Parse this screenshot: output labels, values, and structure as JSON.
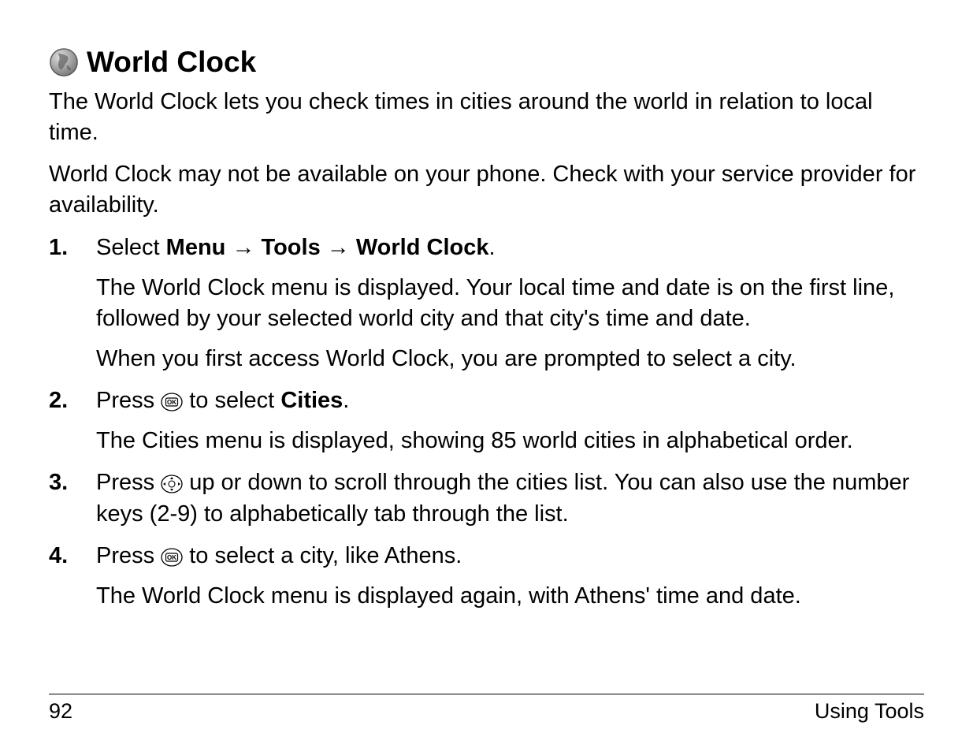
{
  "heading": "World Clock",
  "intro1": "The World Clock lets you check times in cities around the world in relation to local time.",
  "intro2": "World Clock may not be available on your phone. Check with your service provider for availability.",
  "steps": {
    "s1": {
      "prefix": "Select ",
      "menu": "Menu",
      "tools": "Tools",
      "wc": "World Clock",
      "period": ".",
      "detail1": "The World Clock menu is displayed. Your local time and date is on the first line, followed by your selected world city and that city's time and date.",
      "detail2": "When you first access World Clock, you are prompted to select a city."
    },
    "s2": {
      "prefix": "Press ",
      "mid": " to select ",
      "cities": "Cities",
      "period": ".",
      "detail": "The Cities menu is displayed, showing 85 world cities in alphabetical order."
    },
    "s3": {
      "prefix": "Press ",
      "rest": " up or down to scroll through the cities list. You can also use the number keys (2-9) to alphabetically tab through the list."
    },
    "s4": {
      "prefix": "Press ",
      "rest": " to select a city, like Athens.",
      "detail": "The World Clock menu is displayed again, with Athens' time and date."
    }
  },
  "footer": {
    "page": "92",
    "section": "Using Tools"
  },
  "arrow": "→"
}
